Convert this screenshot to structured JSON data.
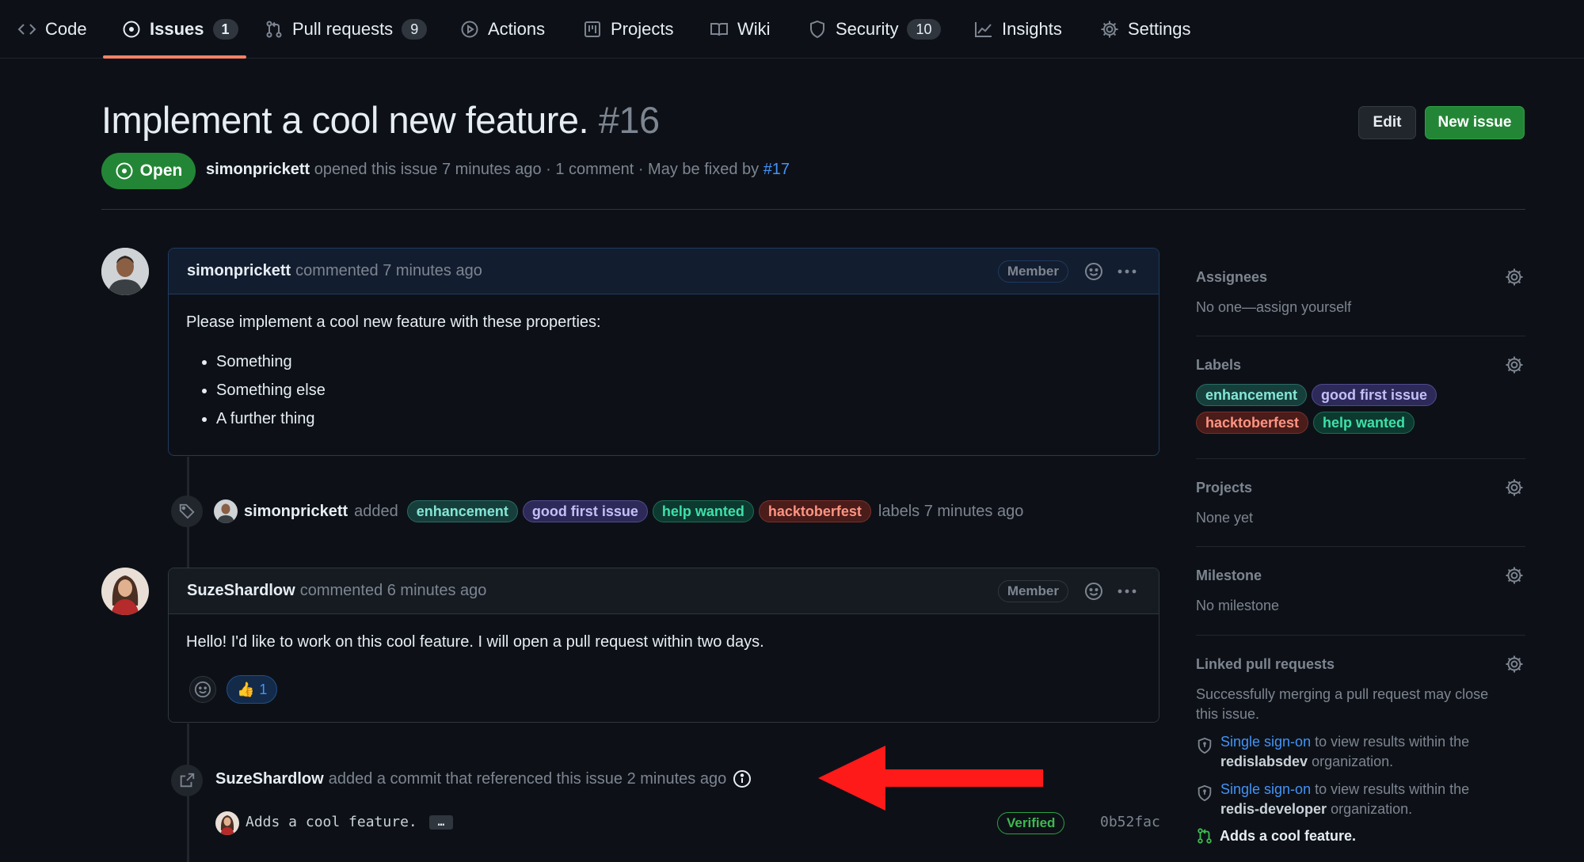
{
  "nav": {
    "tabs": [
      {
        "label": "Code"
      },
      {
        "label": "Issues",
        "count": "1"
      },
      {
        "label": "Pull requests",
        "count": "9"
      },
      {
        "label": "Actions"
      },
      {
        "label": "Projects"
      },
      {
        "label": "Wiki"
      },
      {
        "label": "Security",
        "count": "10"
      },
      {
        "label": "Insights"
      },
      {
        "label": "Settings"
      }
    ],
    "active_tab": "Issues"
  },
  "issue": {
    "title": "Implement a cool new feature.",
    "number": "#16",
    "state": "Open",
    "author": "simonprickett",
    "meta_text": "opened this issue 7 minutes ago · 1 comment · May be fixed by",
    "fixed_by": "#17",
    "edit_label": "Edit",
    "new_issue_label": "New issue"
  },
  "comments": [
    {
      "author": "simonprickett",
      "time": "commented 7 minutes ago",
      "role": "Member",
      "body": "Please implement a cool new feature with these properties:",
      "list": [
        "Something",
        "Something else",
        "A further thing"
      ]
    },
    {
      "author": "SuzeShardlow",
      "time": "commented 6 minutes ago",
      "role": "Member",
      "body": "Hello! I'd like to work on this cool feature. I will open a pull request within two days.",
      "reaction": {
        "emoji": "👍",
        "count": "1"
      }
    }
  ],
  "label_event": {
    "actor": "simonprickett",
    "verb": "added",
    "labels": [
      "enhancement",
      "good first issue",
      "help wanted",
      "hacktoberfest"
    ],
    "suffix": "labels 7 minutes ago"
  },
  "commit_event": {
    "actor": "SuzeShardlow",
    "text": "added a commit that referenced this issue 2 minutes ago",
    "commit_message": "Adds a cool feature.",
    "ellipsis": "…",
    "verified": "Verified",
    "sha": "0b52fac"
  },
  "sidebar": {
    "assignees": {
      "heading": "Assignees",
      "value": "No one—assign yourself"
    },
    "labels": {
      "heading": "Labels",
      "items": [
        "enhancement",
        "good first issue",
        "hacktoberfest",
        "help wanted"
      ]
    },
    "projects": {
      "heading": "Projects",
      "value": "None yet"
    },
    "milestone": {
      "heading": "Milestone",
      "value": "No milestone"
    },
    "linked_prs": {
      "heading": "Linked pull requests",
      "note": "Successfully merging a pull request may close this issue.",
      "sso": [
        {
          "link": "Single sign-on",
          "pre": "to view results within the",
          "org": "redislabsdev",
          "post": "organization."
        },
        {
          "link": "Single sign-on",
          "pre": "to view results within the",
          "org": "redis-developer",
          "post": "organization."
        }
      ],
      "pr_title": "Adds a cool feature."
    }
  },
  "colors": {
    "background": "#0d1117",
    "accent_green": "#238636",
    "link_blue": "#4493f8",
    "tab_underline": "#f78166",
    "annotation_arrow": "#ff1a1a"
  }
}
